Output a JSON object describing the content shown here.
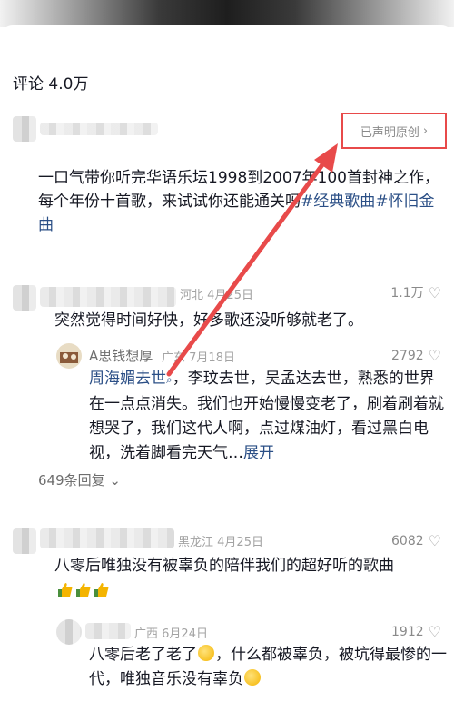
{
  "comments_header": {
    "label": "评论 4.0万"
  },
  "post": {
    "original_badge": "已声明原创",
    "description_prefix": "一口气带你听完华语乐坛1998到2007年100首封神之作，每个年份十首歌，来试试你还能通关吗",
    "tags": [
      "#经典歌曲",
      "#怀旧金曲"
    ]
  },
  "comments": [
    {
      "location": "河北",
      "date": "4月25日",
      "likes": "1.1万",
      "text": "突然觉得时间好快，好多歌还没听够就老了。",
      "reply": {
        "author": "A思钱想厚",
        "location": "广东",
        "date": "7月18日",
        "likes": "2792",
        "mention": "周海媚去世",
        "text": "，李玟去世，吴孟达去世，熟悉的世界在一点点消失。我们也开始慢慢变老了，刷着刷着就想哭了，我们这代人啊，点过煤油灯，看过黑白电视，洗着脚看完天气…",
        "expand_label": "展开"
      },
      "replies_label": "649条回复"
    },
    {
      "location": "黑龙江",
      "date": "4月25日",
      "likes": "6082",
      "text": "八零后唯独没有被辜负的陪伴我们的超好听的歌曲",
      "reply": {
        "location": "广西",
        "date": "6月24日",
        "likes": "1912",
        "text_part1": "八零后老了老了",
        "text_part2": "，什么都被辜负，被坑得最惨的一代，唯独音乐没有辜负"
      }
    }
  ],
  "colors": {
    "highlight_red": "#e84a4a",
    "link_blue": "#2b4f86"
  },
  "icons": {
    "like": "heart-icon",
    "chevron": "chevron-right-icon",
    "search": "search-icon"
  }
}
